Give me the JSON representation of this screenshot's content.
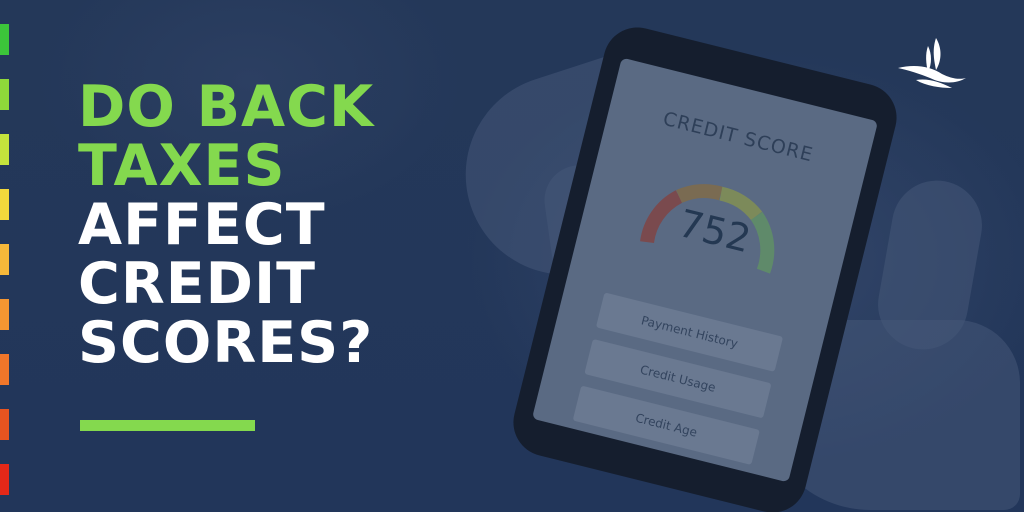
{
  "headline": {
    "line1": "DO BACK",
    "line2": "TAXES",
    "line3": "AFFECT",
    "line4": "CREDIT",
    "line5": "SCORES?"
  },
  "phone": {
    "title": "CREDIT SCORE",
    "score": "752",
    "factors": [
      "Payment History",
      "Credit Usage",
      "Credit Age"
    ]
  },
  "colors": {
    "accent_green": "#84d94e",
    "background_navy": "#24385a",
    "stripes": [
      "#3cc53a",
      "#8fd93a",
      "#c4e33c",
      "#f2d83c",
      "#f6b83a",
      "#f49632",
      "#f0762a",
      "#e75420",
      "#e42818"
    ]
  },
  "icons": {
    "logo": "bird-feather-logo-icon"
  }
}
